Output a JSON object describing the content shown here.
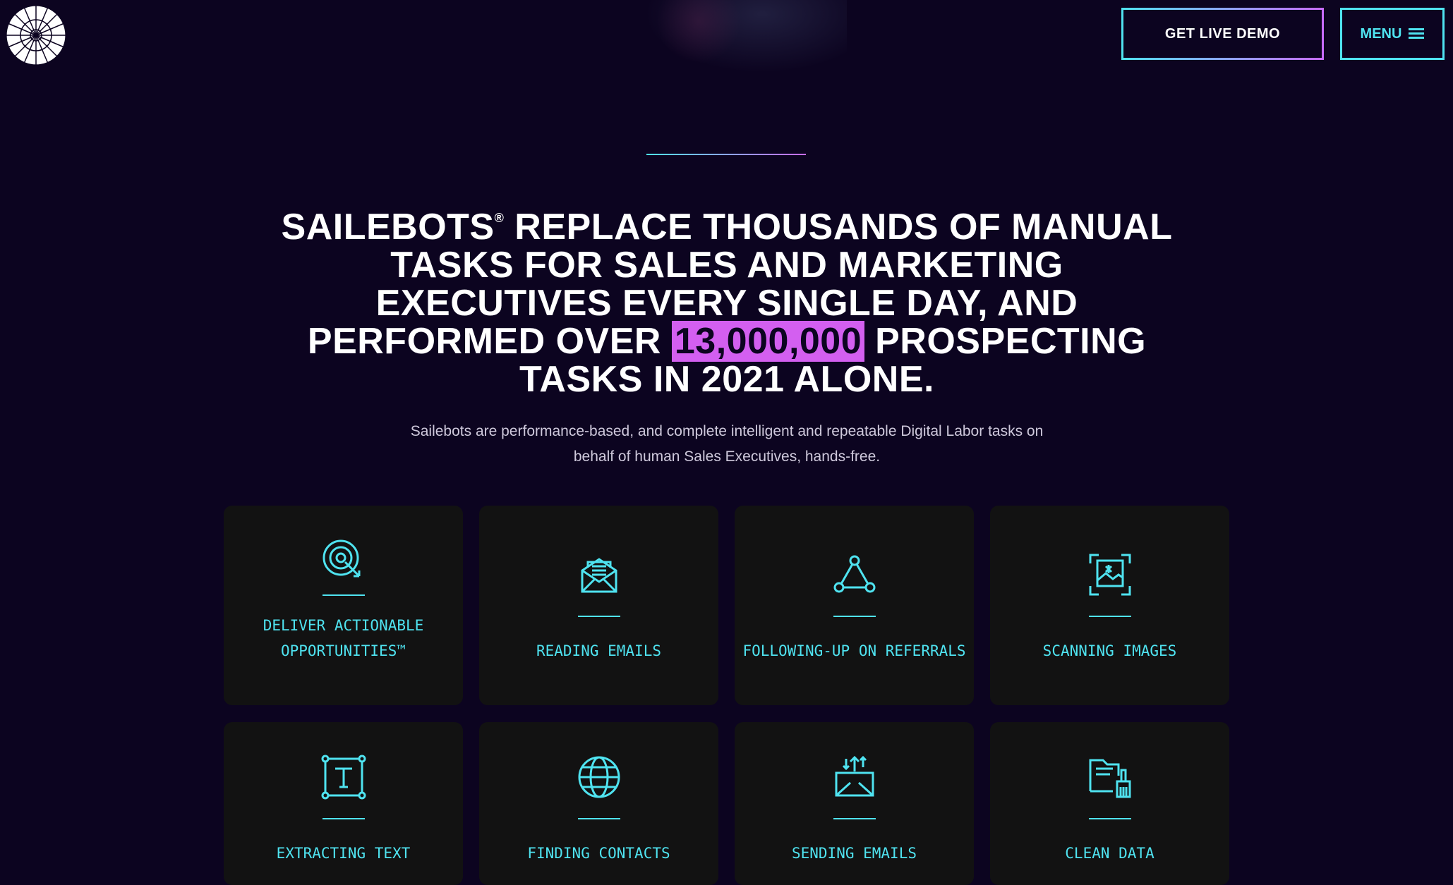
{
  "header": {
    "demo_label": "GET LIVE DEMO",
    "menu_label": "MENU"
  },
  "hero": {
    "headline_part1": "SAILEBOTS",
    "headline_reg": "®",
    "headline_part2": " REPLACE THOUSANDS OF MANUAL TASKS FOR SALES AND MARKETING EXECUTIVES EVERY SINGLE DAY, AND PERFORMED OVER ",
    "headline_highlight": "13,000,000",
    "headline_part3": " PROSPECTING TASKS IN 2021 ALONE.",
    "subtext": "Sailebots are performance-based, and complete intelligent and repeatable Digital Labor tasks on behalf of human Sales Executives, hands-free."
  },
  "cards": [
    {
      "label_line1": "DELIVER ACTIONABLE",
      "label_line2": "OPPORTUNITIES™",
      "icon": "target-icon"
    },
    {
      "label_line1": "READING EMAILS",
      "label_line2": "",
      "icon": "open-envelope-icon"
    },
    {
      "label_line1": "FOLLOWING-UP ON REFERRALS",
      "label_line2": "",
      "icon": "triangle-network-icon"
    },
    {
      "label_line1": "SCANNING IMAGES",
      "label_line2": "",
      "icon": "image-scan-icon"
    },
    {
      "label_line1": "EXTRACTING TEXT",
      "label_line2": "",
      "icon": "text-box-icon"
    },
    {
      "label_line1": "FINDING CONTACTS",
      "label_line2": "",
      "icon": "globe-icon"
    },
    {
      "label_line1": "SENDING EMAILS",
      "label_line2": "",
      "icon": "send-mail-icon"
    },
    {
      "label_line1": "CLEAN DATA",
      "label_line2": "",
      "icon": "clean-folder-icon"
    }
  ],
  "colors": {
    "background": "#0c0420",
    "accent_cyan": "#4fe3f0",
    "accent_pink": "#d35ff0",
    "card_bg": "#121212"
  }
}
